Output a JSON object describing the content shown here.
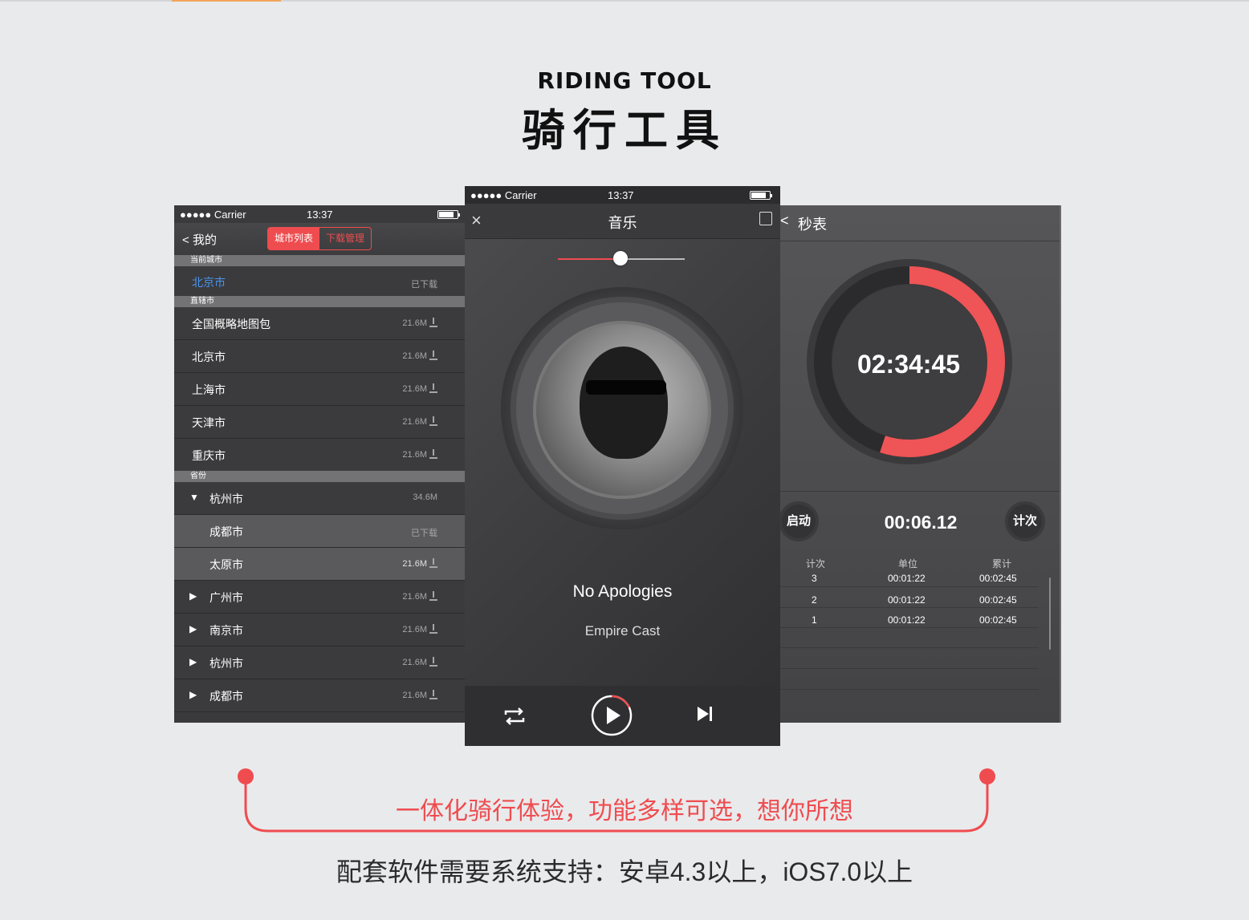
{
  "heading": {
    "en": "RIDING TOOL",
    "zh": "骑行工具"
  },
  "status_bar": {
    "carrier": "●●●●● Carrier",
    "time": "13:37"
  },
  "left": {
    "back_label": "我的",
    "seg_on": "城市列表",
    "seg_off": "下载管理",
    "sections": [
      "当前城市",
      "直辖市",
      "省份"
    ],
    "current_city": {
      "name": "北京市",
      "status": "已下载"
    },
    "municipalities": [
      {
        "name": "全国概略地图包",
        "size": "21.6M"
      },
      {
        "name": "北京市",
        "size": "21.6M"
      },
      {
        "name": "上海市",
        "size": "21.6M"
      },
      {
        "name": "天津市",
        "size": "21.6M"
      },
      {
        "name": "重庆市",
        "size": "21.6M"
      }
    ],
    "province_expanded": {
      "name": "杭州市",
      "size": "34.6M"
    },
    "province_children": [
      {
        "name": "成都市",
        "status": "已下载"
      },
      {
        "name": "太原市",
        "size": "21.6M"
      }
    ],
    "provinces": [
      {
        "name": "广州市",
        "size": "21.6M"
      },
      {
        "name": "南京市",
        "size": "21.6M"
      },
      {
        "name": "杭州市",
        "size": "21.6M"
      },
      {
        "name": "成都市",
        "size": "21.6M"
      }
    ]
  },
  "center": {
    "title": "音乐",
    "song": "No Apologies",
    "artist": "Empire Cast",
    "volume_fraction": 0.5,
    "playback_progress_fraction": 0.18
  },
  "right": {
    "title": "秒表",
    "main_time": "02:34:45",
    "ring_fraction": 0.55,
    "start_label": "启动",
    "lap_label": "计次",
    "lap_time": "00:06.12",
    "columns": [
      "计次",
      "单位",
      "累计"
    ],
    "rows": [
      {
        "n": "3",
        "unit": "00:01:22",
        "total": "00:02:45"
      },
      {
        "n": "2",
        "unit": "00:01:22",
        "total": "00:02:45"
      },
      {
        "n": "1",
        "unit": "00:01:22",
        "total": "00:02:45"
      }
    ]
  },
  "slogan": "一体化骑行体验，功能多样可选，想你所想",
  "note": "配套软件需要系统支持：安卓4.3以上，iOS7.0以上",
  "colors": {
    "accent": "#ef4c4f",
    "link_blue": "#4a95f0",
    "background": "#e9eaec"
  }
}
